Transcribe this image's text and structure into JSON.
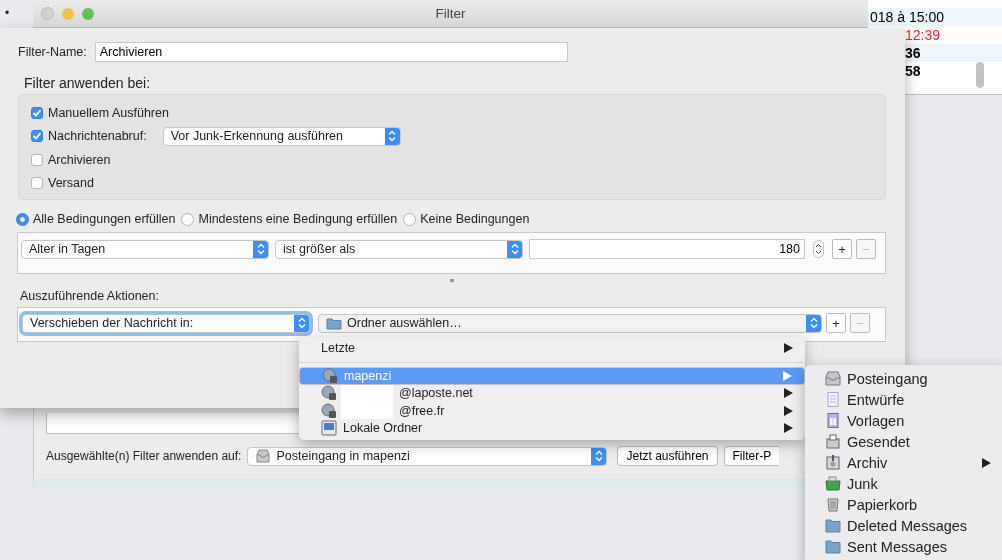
{
  "background_marker": "•",
  "mail_list": {
    "rows": [
      {
        "text": "018 à 15:00",
        "color": "#000000",
        "bold": false
      },
      {
        "text": "12:39",
        "color": "#ff2020",
        "bold": false
      },
      {
        "text": "36",
        "color": "#000000",
        "bold": true
      },
      {
        "text": "58",
        "color": "#000000",
        "bold": true
      }
    ]
  },
  "filter_list_dialog": {
    "apply_label": "Ausgewählte(n) Filter anwenden auf:",
    "apply_target": "Posteingang in mapenzi",
    "run_button": "Jetzt ausführen",
    "log_button": "Filter-P"
  },
  "filter_dialog": {
    "title": "Filter",
    "name_label": "Filter-Name:",
    "name_value": "Archivieren",
    "apply_heading": "Filter anwenden bei:",
    "apply_options": [
      {
        "label": "Manuellem Ausführen",
        "checked": true
      },
      {
        "label": "Nachrichtenabruf:",
        "checked": true,
        "select": "Vor Junk-Erkennung ausführen"
      },
      {
        "label": "Archivieren",
        "checked": false
      },
      {
        "label": "Versand",
        "checked": false
      }
    ],
    "match_options": [
      {
        "label": "Alle Bedingungen erfüllen",
        "selected": true
      },
      {
        "label": "Mindestens eine Bedingung erfüllen",
        "selected": false
      },
      {
        "label": "Keine Bedingungen",
        "selected": false
      }
    ],
    "condition": {
      "field": "Alter in Tagen",
      "operator": "ist größer als",
      "value": "180",
      "add": "+",
      "remove": "−",
      "remove_disabled": true
    },
    "actions_heading": "Auszuführende Aktionen:",
    "action": {
      "type": "Verschieben der Nachricht in:",
      "target": "Ordner auswählen…",
      "add": "+",
      "remove": "−",
      "remove_disabled": true
    }
  },
  "folder_menu": {
    "items": [
      {
        "label": "Letzte",
        "kind": "recent",
        "selected": false
      },
      {
        "label": "mapenzi",
        "kind": "account",
        "selected": true,
        "redacted": false
      },
      {
        "label": "@laposte.net",
        "kind": "account",
        "selected": false,
        "redacted": true
      },
      {
        "label": "@free.fr",
        "kind": "account",
        "selected": false,
        "redacted": true
      },
      {
        "label": "Lokale Ordner",
        "kind": "local",
        "selected": false,
        "redacted": false
      }
    ]
  },
  "folder_submenu": {
    "items": [
      {
        "label": "Posteingang",
        "kind": "inbox",
        "has_submenu": false
      },
      {
        "label": "Entwürfe",
        "kind": "drafts",
        "has_submenu": false
      },
      {
        "label": "Vorlagen",
        "kind": "templates",
        "has_submenu": false
      },
      {
        "label": "Gesendet",
        "kind": "sent",
        "has_submenu": false
      },
      {
        "label": "Archiv",
        "kind": "archive",
        "has_submenu": true
      },
      {
        "label": "Junk",
        "kind": "junk",
        "has_submenu": false
      },
      {
        "label": "Papierkorb",
        "kind": "trash",
        "has_submenu": false
      },
      {
        "label": "Deleted Messages",
        "kind": "folder",
        "has_submenu": false
      },
      {
        "label": "Sent Messages",
        "kind": "folder",
        "has_submenu": false
      }
    ]
  }
}
